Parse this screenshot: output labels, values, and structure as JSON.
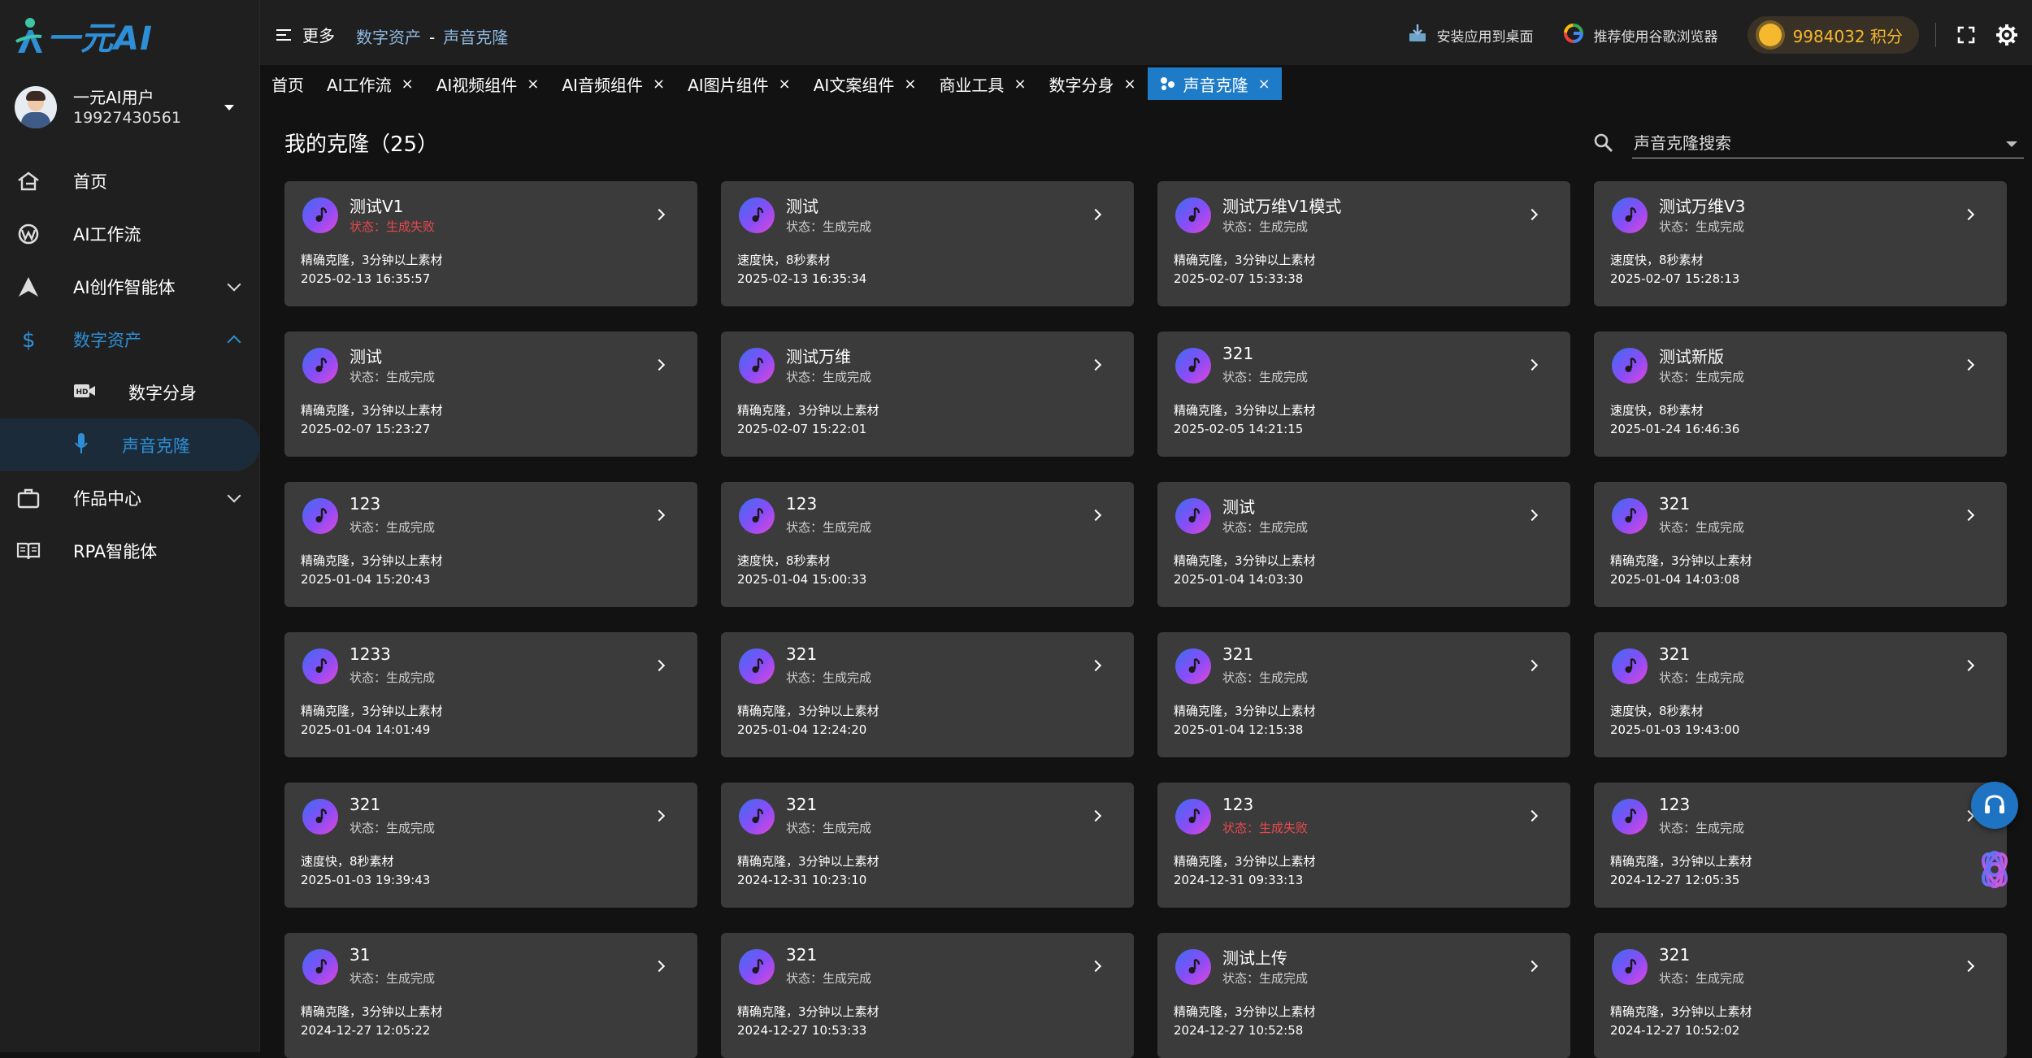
{
  "brand": {
    "logo_text": "一元AI"
  },
  "user": {
    "name": "一元AI用户",
    "phone": "19927430561"
  },
  "sidebar": {
    "items": [
      {
        "label": "首页",
        "icon": "home-icon"
      },
      {
        "label": "AI工作流",
        "icon": "workflow-icon"
      },
      {
        "label": "AI创作智能体",
        "icon": "agent-icon"
      },
      {
        "label": "数字资产",
        "icon": "dollar-icon"
      },
      {
        "label": "数字分身",
        "icon": "hd-video-icon"
      },
      {
        "label": "声音克隆",
        "icon": "microphone-icon"
      },
      {
        "label": "作品中心",
        "icon": "briefcase-icon"
      },
      {
        "label": "RPA智能体",
        "icon": "book-icon"
      }
    ]
  },
  "header": {
    "more_label": "更多",
    "breadcrumb": [
      "数字资产",
      "声音克隆"
    ],
    "install_label": "安装应用到桌面",
    "browser_label": "推荐使用谷歌浏览器",
    "points_label": "9984032 积分"
  },
  "tabs": [
    {
      "label": "首页",
      "closable": false
    },
    {
      "label": "AI工作流",
      "closable": true
    },
    {
      "label": "AI视频组件",
      "closable": true
    },
    {
      "label": "AI音频组件",
      "closable": true
    },
    {
      "label": "AI图片组件",
      "closable": true
    },
    {
      "label": "AI文案组件",
      "closable": true
    },
    {
      "label": "商业工具",
      "closable": true
    },
    {
      "label": "数字分身",
      "closable": true
    },
    {
      "label": "声音克隆",
      "closable": true,
      "active": true
    }
  ],
  "tab_close_symbol": "×",
  "main": {
    "title": "我的克隆（25）",
    "search_placeholder": "声音克隆搜索"
  },
  "status_prefix": "状态：",
  "clones": [
    {
      "name": "测试V1",
      "status": "状态：生成失败",
      "failed": true,
      "desc": "精确克隆，3分钟以上素材",
      "date": "2025-02-13 16:35:57"
    },
    {
      "name": "测试",
      "status": "状态：生成完成",
      "failed": false,
      "desc": "速度快，8秒素材",
      "date": "2025-02-13 16:35:34"
    },
    {
      "name": "测试万维V1模式",
      "status": "状态：生成完成",
      "failed": false,
      "desc": "精确克隆，3分钟以上素材",
      "date": "2025-02-07 15:33:38"
    },
    {
      "name": "测试万维V3",
      "status": "状态：生成完成",
      "failed": false,
      "desc": "速度快，8秒素材",
      "date": "2025-02-07 15:28:13"
    },
    {
      "name": "测试",
      "status": "状态：生成完成",
      "failed": false,
      "desc": "精确克隆，3分钟以上素材",
      "date": "2025-02-07 15:23:27"
    },
    {
      "name": "测试万维",
      "status": "状态：生成完成",
      "failed": false,
      "desc": "精确克隆，3分钟以上素材",
      "date": "2025-02-07 15:22:01"
    },
    {
      "name": "321",
      "status": "状态：生成完成",
      "failed": false,
      "desc": "精确克隆，3分钟以上素材",
      "date": "2025-02-05 14:21:15"
    },
    {
      "name": "测试新版",
      "status": "状态：生成完成",
      "failed": false,
      "desc": "速度快，8秒素材",
      "date": "2025-01-24 16:46:36"
    },
    {
      "name": "123",
      "status": "状态：生成完成",
      "failed": false,
      "desc": "精确克隆，3分钟以上素材",
      "date": "2025-01-04 15:20:43"
    },
    {
      "name": "123",
      "status": "状态：生成完成",
      "failed": false,
      "desc": "速度快，8秒素材",
      "date": "2025-01-04 15:00:33"
    },
    {
      "name": "测试",
      "status": "状态：生成完成",
      "failed": false,
      "desc": "精确克隆，3分钟以上素材",
      "date": "2025-01-04 14:03:30"
    },
    {
      "name": "321",
      "status": "状态：生成完成",
      "failed": false,
      "desc": "精确克隆，3分钟以上素材",
      "date": "2025-01-04 14:03:08"
    },
    {
      "name": "1233",
      "status": "状态：生成完成",
      "failed": false,
      "desc": "精确克隆，3分钟以上素材",
      "date": "2025-01-04 14:01:49"
    },
    {
      "name": "321",
      "status": "状态：生成完成",
      "failed": false,
      "desc": "精确克隆，3分钟以上素材",
      "date": "2025-01-04 12:24:20"
    },
    {
      "name": "321",
      "status": "状态：生成完成",
      "failed": false,
      "desc": "精确克隆，3分钟以上素材",
      "date": "2025-01-04 12:15:38"
    },
    {
      "name": "321",
      "status": "状态：生成完成",
      "failed": false,
      "desc": "速度快，8秒素材",
      "date": "2025-01-03 19:43:00"
    },
    {
      "name": "321",
      "status": "状态：生成完成",
      "failed": false,
      "desc": "速度快，8秒素材",
      "date": "2025-01-03 19:39:43"
    },
    {
      "name": "321",
      "status": "状态：生成完成",
      "failed": false,
      "desc": "精确克隆，3分钟以上素材",
      "date": "2024-12-31 10:23:10"
    },
    {
      "name": "123",
      "status": "状态：生成失败",
      "failed": true,
      "desc": "精确克隆，3分钟以上素材",
      "date": "2024-12-31 09:33:13"
    },
    {
      "name": "123",
      "status": "状态：生成完成",
      "failed": false,
      "desc": "精确克隆，3分钟以上素材",
      "date": "2024-12-27 12:05:35"
    },
    {
      "name": "31",
      "status": "状态：生成完成",
      "failed": false,
      "desc": "精确克隆，3分钟以上素材",
      "date": "2024-12-27 12:05:22"
    },
    {
      "name": "321",
      "status": "状态：生成完成",
      "failed": false,
      "desc": "精确克隆，3分钟以上素材",
      "date": "2024-12-27 10:53:33"
    },
    {
      "name": "测试上传",
      "status": "状态：生成完成",
      "failed": false,
      "desc": "精确克隆，3分钟以上素材",
      "date": "2024-12-27 10:52:58"
    },
    {
      "name": "321",
      "status": "状态：生成完成",
      "failed": false,
      "desc": "精确克隆，3分钟以上素材",
      "date": "2024-12-27 10:52:02"
    }
  ],
  "colors": {
    "accent": "#2e8fd6",
    "fail": "#e8484d",
    "points": "#f5b82e",
    "active_tab": "#1e7bc8"
  }
}
